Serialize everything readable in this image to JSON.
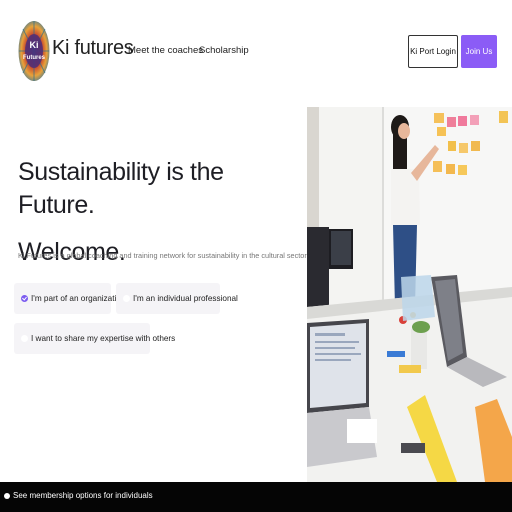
{
  "brand": {
    "name": "Ki futures",
    "logo_text": "Ki\nFutures",
    "logo_icon": "ki-futures-logo"
  },
  "nav": {
    "coaches": "Meet the coaches",
    "scholarship": "Scholarship"
  },
  "header_buttons": {
    "login": "Ki Port Login",
    "join": "Join Us",
    "join_color": "#8b5cf6"
  },
  "hero": {
    "title_line1": "Sustainability is the Future.",
    "title_line2": "Welcome.",
    "subtitle": "Ki Futures is a global coaching and training network for sustainability in the cultural sector."
  },
  "options": {
    "organization": {
      "label": "I'm part of an organization",
      "selected": true
    },
    "individual": {
      "label": "I'm an individual professional",
      "selected": false
    },
    "share": {
      "label": "I want to share my expertise with others",
      "selected": false
    },
    "accent_color": "#7c5cf0"
  },
  "photo": {
    "icon": "office-photo"
  },
  "bottom_bar": {
    "text": "See membership options for individuals"
  }
}
